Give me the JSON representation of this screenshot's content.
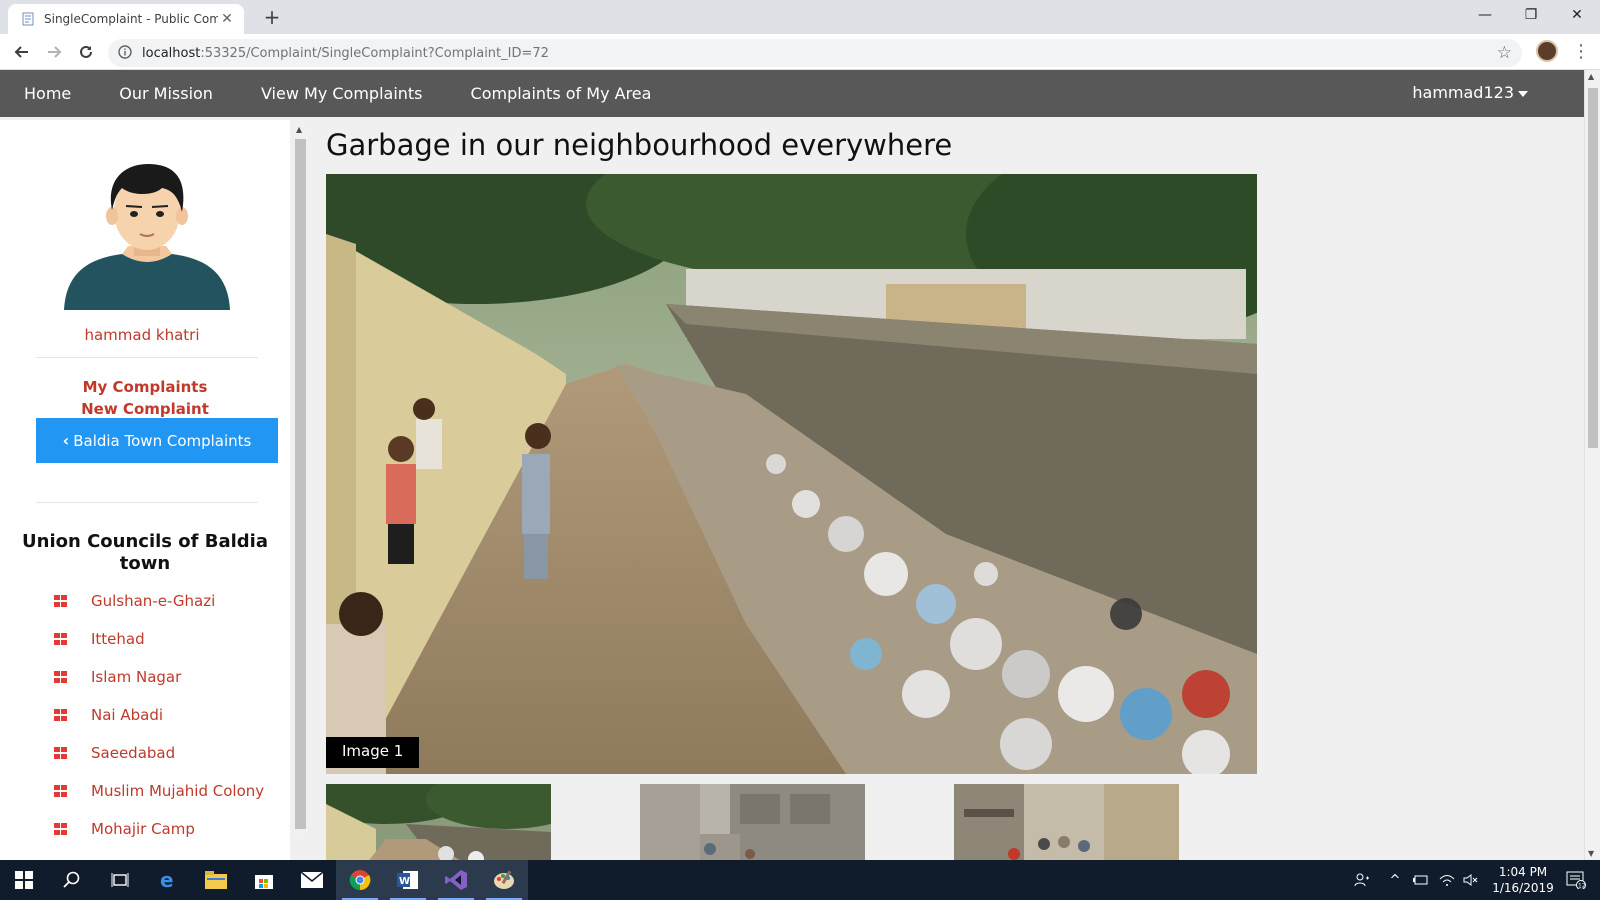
{
  "browser": {
    "tab_title": "SingleComplaint - Public Compla",
    "url_host": "localhost",
    "url_rest": ":53325/Complaint/SingleComplaint?Complaint_ID=72"
  },
  "nav": {
    "links": [
      "Home",
      "Our Mission",
      "View My Complaints",
      "Complaints of My Area"
    ],
    "user": "hammad123"
  },
  "sidebar": {
    "user_name": "hammad khatri",
    "my_complaints": "My Complaints",
    "new_complaint": "New Complaint",
    "area_button": "Baldia Town Complaints",
    "uc_title": "Union Councils of Baldia town",
    "uc_items": [
      "Gulshan-e-Ghazi",
      "Ittehad",
      "Islam Nagar",
      "Nai Abadi",
      "Saeedabad",
      "Muslim Mujahid Colony",
      "Mohajir Camp"
    ]
  },
  "complaint": {
    "title": "Garbage in our neighbourhood everywhere",
    "image_caption": "Image 1"
  },
  "taskbar": {
    "time": "1:04 PM",
    "date": "1/16/2019",
    "notifications": "12"
  },
  "colors": {
    "nav_bg": "#585858",
    "accent_red": "#c0392b",
    "button_blue": "#2196f3",
    "taskbar_bg": "#101c2b"
  }
}
